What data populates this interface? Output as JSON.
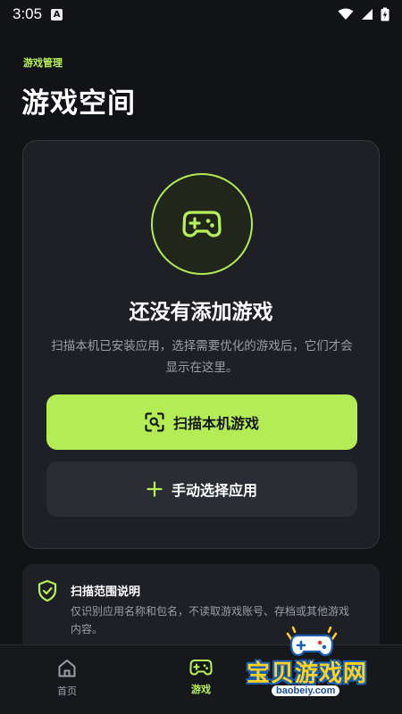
{
  "status": {
    "time": "3:05",
    "app_indicator": "A"
  },
  "header": {
    "section_label": "游戏管理",
    "title": "游戏空间"
  },
  "empty_state": {
    "icon": "gamepad-icon",
    "title": "还没有添加游戏",
    "description": "扫描本机已安装应用，选择需要优化的游戏后，它们才会显示在这里。",
    "primary_button": {
      "label": "扫描本机游戏",
      "icon": "scan-icon"
    },
    "secondary_button": {
      "label": "手动选择应用",
      "icon": "plus-icon"
    }
  },
  "info_card": {
    "icon": "shield-check-icon",
    "title": "扫描范围说明",
    "text": "仅识别应用名称和包名，不读取游戏账号、存档或其他游戏内容。"
  },
  "bottom_nav": {
    "items": [
      {
        "label": "首页",
        "icon": "home-icon",
        "active": false
      },
      {
        "label": "游戏",
        "icon": "gamepad-icon",
        "active": true
      }
    ]
  },
  "watermark": {
    "text": "宝贝游戏网",
    "url": "baobeiy.com"
  },
  "colors": {
    "background": "#121317",
    "card": "#1e2026",
    "accent": "#b3ec55",
    "muted_text": "#9a9ea8"
  }
}
